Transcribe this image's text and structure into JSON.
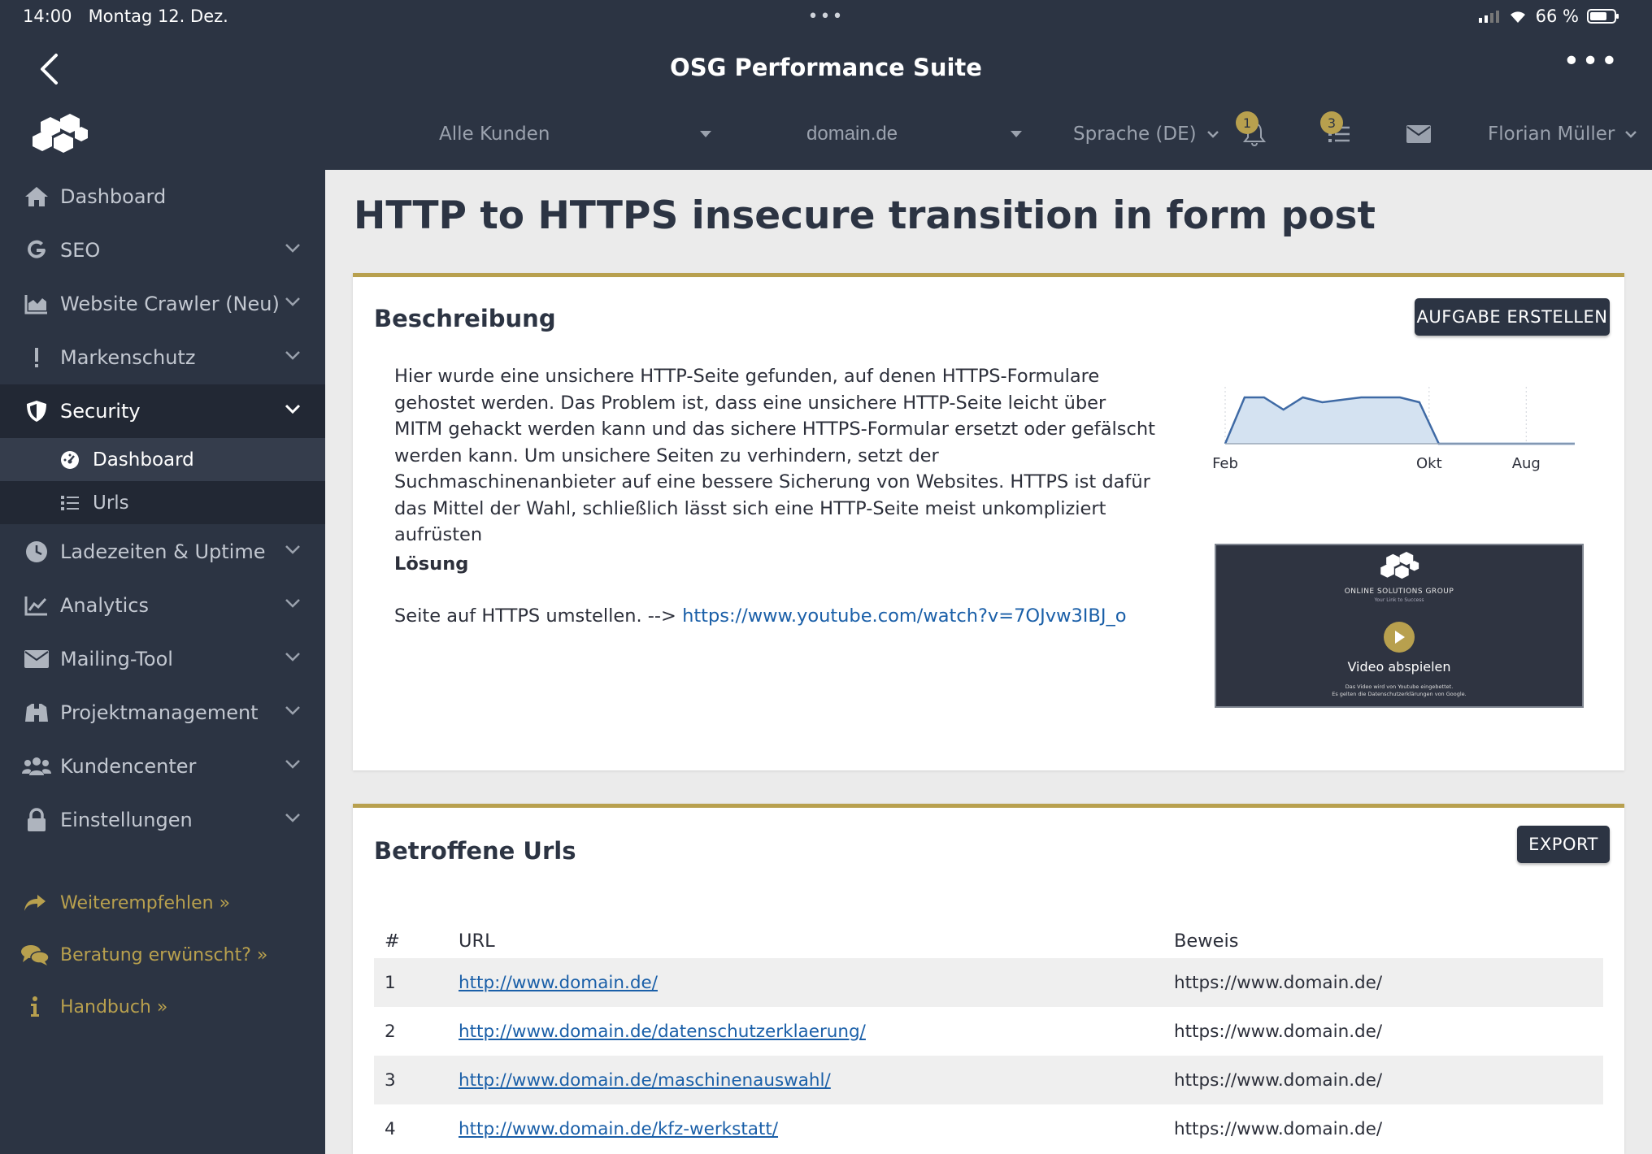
{
  "status_bar": {
    "time": "14:00",
    "date": "Montag 12. Dez.",
    "battery": "66 %"
  },
  "app_title": "OSG Performance Suite",
  "toolbar": {
    "customer": "Alle Kunden",
    "domain": "domain.de",
    "language": "Sprache (DE)",
    "notifications_count": "1",
    "tasks_count": "3",
    "user": "Florian Müller"
  },
  "sidebar": {
    "items": [
      {
        "label": "Dashboard",
        "icon": "home-icon"
      },
      {
        "label": "SEO",
        "icon": "google-icon"
      },
      {
        "label": "Website Crawler (Neu)",
        "icon": "area-chart-icon"
      },
      {
        "label": "Markenschutz",
        "icon": "exclamation-icon"
      },
      {
        "label": "Security",
        "icon": "shield-icon"
      },
      {
        "label": "Ladezeiten & Uptime",
        "icon": "clock-icon"
      },
      {
        "label": "Analytics",
        "icon": "line-chart-icon"
      },
      {
        "label": "Mailing-Tool",
        "icon": "envelope-icon"
      },
      {
        "label": "Projektmanagement",
        "icon": "binoculars-icon"
      },
      {
        "label": "Kundencenter",
        "icon": "users-icon"
      },
      {
        "label": "Einstellungen",
        "icon": "lock-icon"
      }
    ],
    "security_sub": [
      {
        "label": "Dashboard",
        "icon": "dashboard-gauge-icon"
      },
      {
        "label": "Urls",
        "icon": "list-icon"
      }
    ],
    "extras": [
      {
        "label": "Weiterempfehlen »",
        "icon": "share-icon"
      },
      {
        "label": "Beratung erwünscht? »",
        "icon": "chat-icon"
      },
      {
        "label": "Handbuch »",
        "icon": "info-icon"
      }
    ]
  },
  "page_title": "HTTP to HTTPS insecure transition in form post",
  "description_card": {
    "heading": "Beschreibung",
    "create_task_button": "AUFGABE ERSTELLEN",
    "text": "Hier wurde eine unsichere HTTP-Seite gefunden, auf denen HTTPS-Formulare gehostet werden. Das Problem ist, dass eine unsichere HTTP-Seite leicht über MITM gehackt werden kann und das sichere HTTPS-Formular ersetzt oder gefälscht werden kann. Um unsichere Seiten zu verhindern, setzt der Suchmaschinenanbieter auf eine bessere Sicherung von Websites. HTTPS ist dafür das Mittel der Wahl, schließlich lässt sich eine HTTP-Seite meist unkompliziert aufrüsten",
    "solution_heading": "Lösung",
    "solution_text": "Seite auf HTTPS umstellen. -->",
    "solution_link": "https://www.youtube.com/watch?v=7OJvw3IBJ_o"
  },
  "chart_data": {
    "type": "area",
    "x_tick_labels": [
      "Feb",
      "Okt",
      "Aug"
    ],
    "y_range": [
      0,
      1
    ],
    "series": [
      {
        "values": [
          0,
          0.95,
          0.95,
          0.7,
          0.95,
          0.85,
          0.9,
          0.95,
          0.95,
          0.95,
          0.85,
          0,
          0,
          0,
          0,
          0,
          0,
          0,
          0
        ]
      }
    ]
  },
  "video": {
    "brand": "ONLINE SOLUTIONS GROUP",
    "tagline": "Your Link to Success",
    "play_label": "Video abspielen",
    "note_line1": "Das Video wird von Youtube eingebettet.",
    "note_line2": "Es gelten die Datenschutzerklärungen von Google."
  },
  "urls_card": {
    "heading": "Betroffene Urls",
    "export_button": "EXPORT",
    "columns": [
      "#",
      "URL",
      "Beweis"
    ],
    "rows": [
      {
        "num": "1",
        "url": "http://www.domain.de/",
        "proof": "https://www.domain.de/"
      },
      {
        "num": "2",
        "url": "http://www.domain.de/datenschutzerklaerung/",
        "proof": "https://www.domain.de/"
      },
      {
        "num": "3",
        "url": "http://www.domain.de/maschinenauswahl/",
        "proof": "https://www.domain.de/"
      },
      {
        "num": "4",
        "url": "http://www.domain.de/kfz-werkstatt/",
        "proof": "https://www.domain.de/"
      }
    ]
  },
  "colors": {
    "nav_bg": "#2c3443",
    "accent_gold": "#b8a04e",
    "link_blue": "#1a5fa8",
    "content_bg": "#ebebeb"
  }
}
